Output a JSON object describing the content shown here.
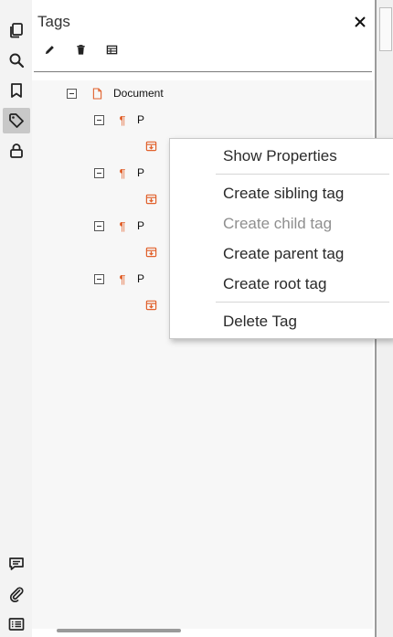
{
  "rail": {
    "top_icons": [
      "pages-icon",
      "search-icon",
      "bookmark-icon",
      "tag-icon",
      "lock-icon"
    ],
    "bottom_icons": [
      "comment-icon",
      "attachment-icon",
      "layers-list-icon"
    ],
    "active": "tag-icon"
  },
  "panel": {
    "title": "Tags",
    "toolbar": [
      "edit-icon",
      "delete-icon",
      "table-icon"
    ]
  },
  "tree": {
    "root": "Document",
    "paragraphs": [
      {
        "label": "P"
      },
      {
        "label": "P"
      },
      {
        "label": "P"
      },
      {
        "label": "P"
      }
    ]
  },
  "context_menu": {
    "items": [
      {
        "label": "Show Properties",
        "enabled": true
      },
      {
        "label": "Create sibling tag",
        "enabled": true
      },
      {
        "label": "Create child tag",
        "enabled": false
      },
      {
        "label": "Create parent tag",
        "enabled": true
      },
      {
        "label": "Create root tag",
        "enabled": true
      },
      {
        "label": "Delete Tag",
        "enabled": true
      }
    ]
  },
  "colors": {
    "accent": "#e1612c",
    "rail_bg": "#f3f3f3",
    "active_bg": "#c8c8c8",
    "disabled_text": "#8f8f8f"
  }
}
